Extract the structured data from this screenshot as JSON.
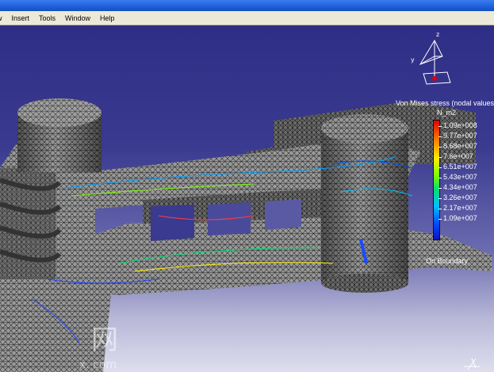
{
  "menu": {
    "items": [
      "w",
      "Insert",
      "Tools",
      "Window",
      "Help"
    ]
  },
  "compass": {
    "z_label": "z",
    "y_label": "y"
  },
  "legend": {
    "title": "Von Mises stress (nodal values)",
    "unit": "N_m2",
    "values": [
      "1.09e+008",
      "9.77e+007",
      "8.68e+007",
      "7.6e+007",
      "6.51e+007",
      "5.43e+007",
      "4.34e+007",
      "3.26e+007",
      "2.17e+007",
      "1.09e+007"
    ],
    "boundary": "On Boundary",
    "scale_colors": [
      "#e00000",
      "#ff7a00",
      "#ffee00",
      "#7cff00",
      "#00e070",
      "#00c0ff",
      "#0050ff",
      "#1010c0"
    ]
  },
  "watermark": {
    "text": "网",
    "domain": "x. com"
  }
}
